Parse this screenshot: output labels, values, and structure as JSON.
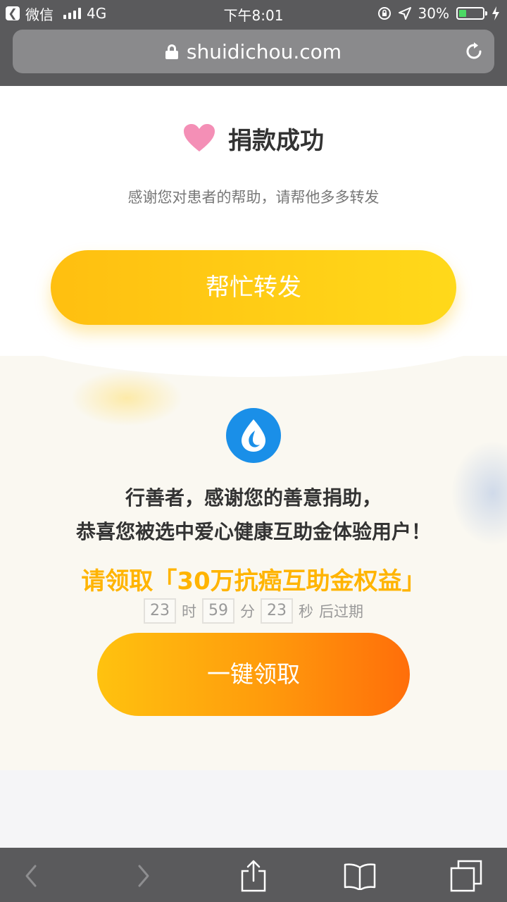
{
  "status_bar": {
    "back_app": "微信",
    "network": "4G",
    "time": "下午8:01",
    "battery_text": "30%",
    "battery_level": 0.3
  },
  "address_bar": {
    "url": "shuidichou.com"
  },
  "success": {
    "title": "捐款成功",
    "subtitle": "感谢您对患者的帮助，请帮他多多转发",
    "share_button": "帮忙转发"
  },
  "promo": {
    "line1": "行善者，感谢您的善意捐助，",
    "line2": "恭喜您被选中爱心健康互助金体验用户！",
    "claim_title": "请领取「30万抗癌互助金权益」",
    "countdown": {
      "hours": "23",
      "hours_unit": "时",
      "minutes": "59",
      "minutes_unit": "分",
      "seconds": "23",
      "seconds_unit": "秒",
      "suffix": "后过期"
    },
    "claim_button": "一键领取"
  },
  "colors": {
    "bar_gray": "#5a5a5c",
    "share_yellow": "#ffc914",
    "claim_orange": "#ff6e0a",
    "title_gold": "#ffb400",
    "logo_blue": "#1a8fe8"
  }
}
